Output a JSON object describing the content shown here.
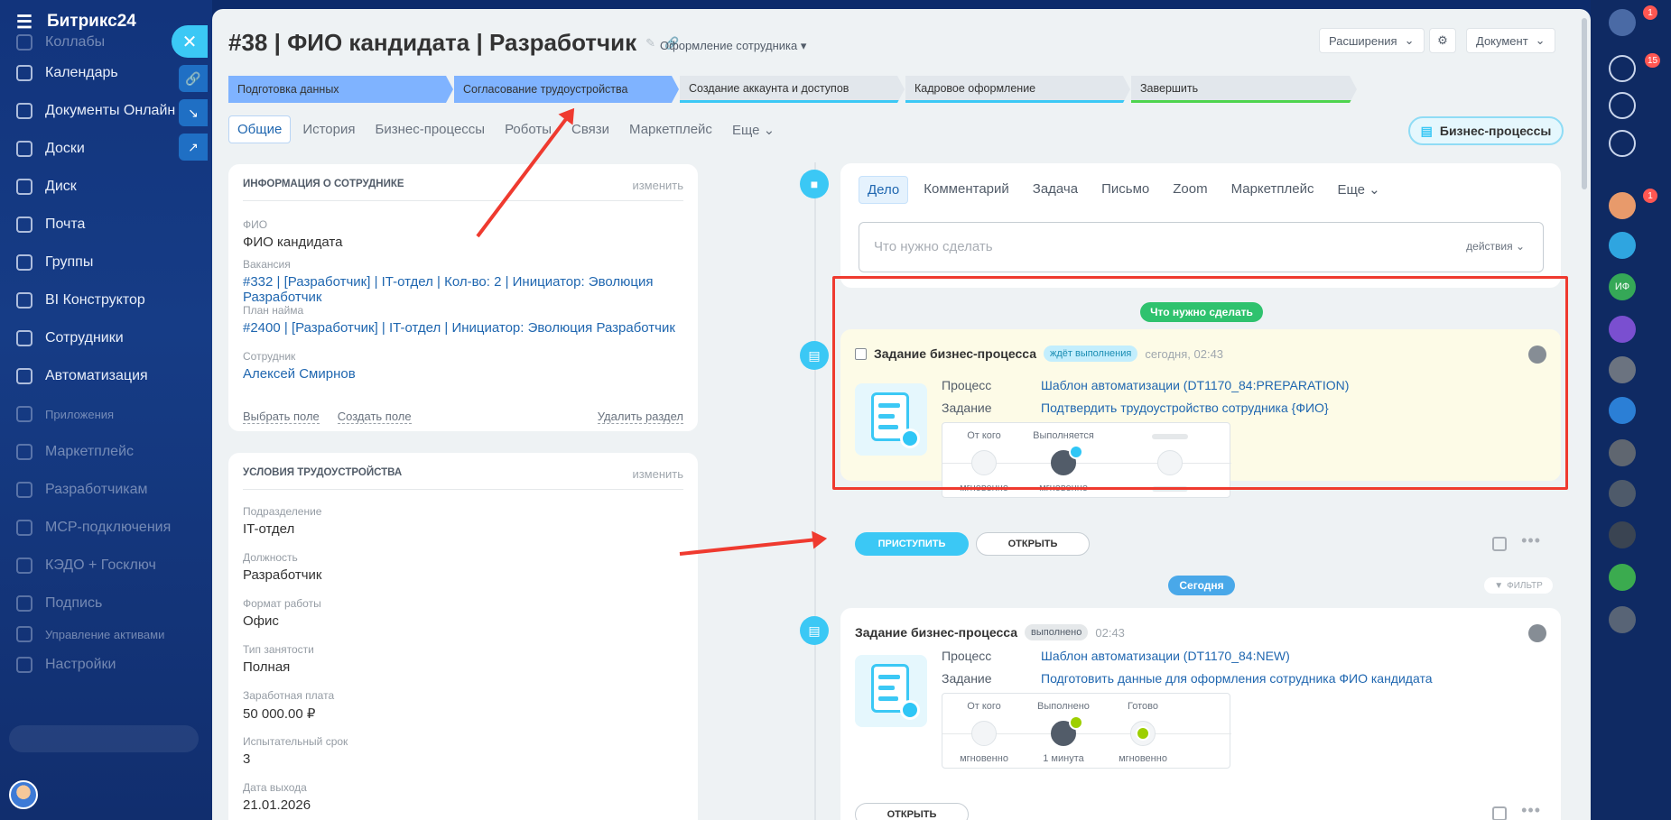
{
  "sidebar": {
    "brand": "Битрикс24",
    "items": [
      {
        "label": "Коллабы"
      },
      {
        "label": "Календарь"
      },
      {
        "label": "Документы Онлайн"
      },
      {
        "label": "Доски"
      },
      {
        "label": "Диск"
      },
      {
        "label": "Почта"
      },
      {
        "label": "Группы"
      },
      {
        "label": "BI Конструктор"
      },
      {
        "label": "Сотрудники"
      },
      {
        "label": "Автоматизация"
      },
      {
        "label": "Приложения"
      },
      {
        "label": "Маркетплейс"
      },
      {
        "label": "Разработчикам"
      },
      {
        "label": "MCP-подключения"
      },
      {
        "label": "КЭДО + Госключ"
      },
      {
        "label": "Подпись"
      },
      {
        "label": "Управление активами"
      },
      {
        "label": "Настройки"
      }
    ]
  },
  "right_sidebar": {
    "notify_count_1": "1",
    "notify_count_2": "15",
    "avatar_count": "1",
    "initials": "ИФ"
  },
  "header": {
    "title": "#38 | ФИО кандидата | Разработчик",
    "stage_select": "Оформление сотрудника",
    "extensions": "Расширения",
    "document": "Документ"
  },
  "stages": [
    {
      "label": "Подготовка данных"
    },
    {
      "label": "Согласование трудоустройства"
    },
    {
      "label": "Создание аккаунта и доступов"
    },
    {
      "label": "Кадровое оформление"
    },
    {
      "label": "Завершить"
    }
  ],
  "tabs": [
    "Общие",
    "История",
    "Бизнес-процессы",
    "Роботы",
    "Связи",
    "Маркетплейс",
    "Еще"
  ],
  "bp_button": "Бизнес-процессы",
  "employee_card": {
    "header": "Информация о сотруднике",
    "change": "изменить",
    "fields": [
      {
        "label": "ФИО",
        "value": "ФИО кандидата"
      },
      {
        "label": "Вакансия",
        "value": "#332 | [Разработчик] | IT-отдел | Кол-во: 2 | Инициатор: Эволюция Разработчик"
      },
      {
        "label": "План найма",
        "value": "#2400 | [Разработчик] | IT-отдел | Инициатор: Эволюция Разработчик"
      },
      {
        "label": "Сотрудник",
        "value": "Алексей Смирнов"
      }
    ],
    "footer": {
      "select": "Выбрать поле",
      "create": "Создать поле",
      "delete": "Удалить раздел"
    }
  },
  "conditions_card": {
    "header": "Условия трудоустройства",
    "change": "изменить",
    "fields": [
      {
        "label": "Подразделение",
        "value": "IT-отдел"
      },
      {
        "label": "Должность",
        "value": "Разработчик"
      },
      {
        "label": "Формат работы",
        "value": "Офис"
      },
      {
        "label": "Тип занятости",
        "value": "Полная"
      },
      {
        "label": "Заработная плата",
        "value": "50 000.00 ₽"
      },
      {
        "label": "Испытательный срок",
        "value": "3"
      },
      {
        "label": "Дата выхода",
        "value": "21.01.2026"
      }
    ]
  },
  "editor": {
    "tabs": [
      "Дело",
      "Комментарий",
      "Задача",
      "Письмо",
      "Zoom",
      "Маркетплейс",
      "Еще"
    ],
    "placeholder": "Что нужно сделать",
    "actions": "действия"
  },
  "pill_todo": "Что нужно сделать",
  "pill_today": "Сегодня",
  "filter": "ФИЛЬТР",
  "activity1": {
    "title": "Задание бизнес-процесса",
    "badge": "ждёт выполнения",
    "time": "сегодня, 02:43",
    "process_label": "Процесс",
    "process_value": "Шаблон автоматизации (DT1170_84:PREPARATION)",
    "task_label": "Задание",
    "task_value": "Подтвердить трудоустройство сотрудника {ФИО}",
    "wf_from": "От кого",
    "wf_doing": "Выполняется",
    "wf_from_time": "мгновенно",
    "wf_doing_time": "мгновенно",
    "start": "ПРИСТУПИТЬ",
    "open": "ОТКРЫТЬ"
  },
  "activity2": {
    "title": "Задание бизнес-процесса",
    "badge": "выполнено",
    "time": "02:43",
    "process_label": "Процесс",
    "process_value": "Шаблон автоматизации (DT1170_84:NEW)",
    "task_label": "Задание",
    "task_value": "Подготовить данные для оформления сотрудника ФИО кандидата",
    "wf_from": "От кого",
    "wf_done": "Выполнено",
    "wf_ready": "Готово",
    "wf_from_time": "мгновенно",
    "wf_done_time": "1 минута",
    "wf_ready_time": "мгновенно",
    "open": "ОТКРЫТЬ"
  },
  "colors": {
    "accent": "#3bc8f5",
    "link": "#2067b0",
    "highlight": "#ef3a2f",
    "pending_bg": "#fdfbe7"
  }
}
